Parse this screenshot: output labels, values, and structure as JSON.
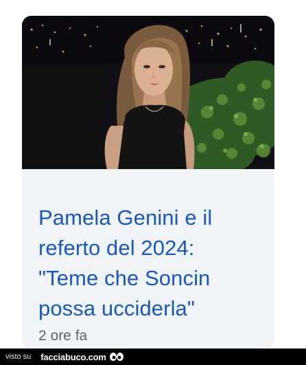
{
  "article": {
    "headline": "Pamela Genini e il referto del 2024: \"Teme che Soncin possa ucciderla\"",
    "timestamp": "2 ore fa",
    "image_alt": "photo"
  },
  "watermark": {
    "prefix": "visto su",
    "site": "facciabuco.com",
    "logo": "eyes-icon"
  },
  "colors": {
    "headline": "#1a57b8",
    "card_background": "#f0f4f9",
    "timestamp": "#5f6368",
    "watermark_bar": "#000000"
  }
}
